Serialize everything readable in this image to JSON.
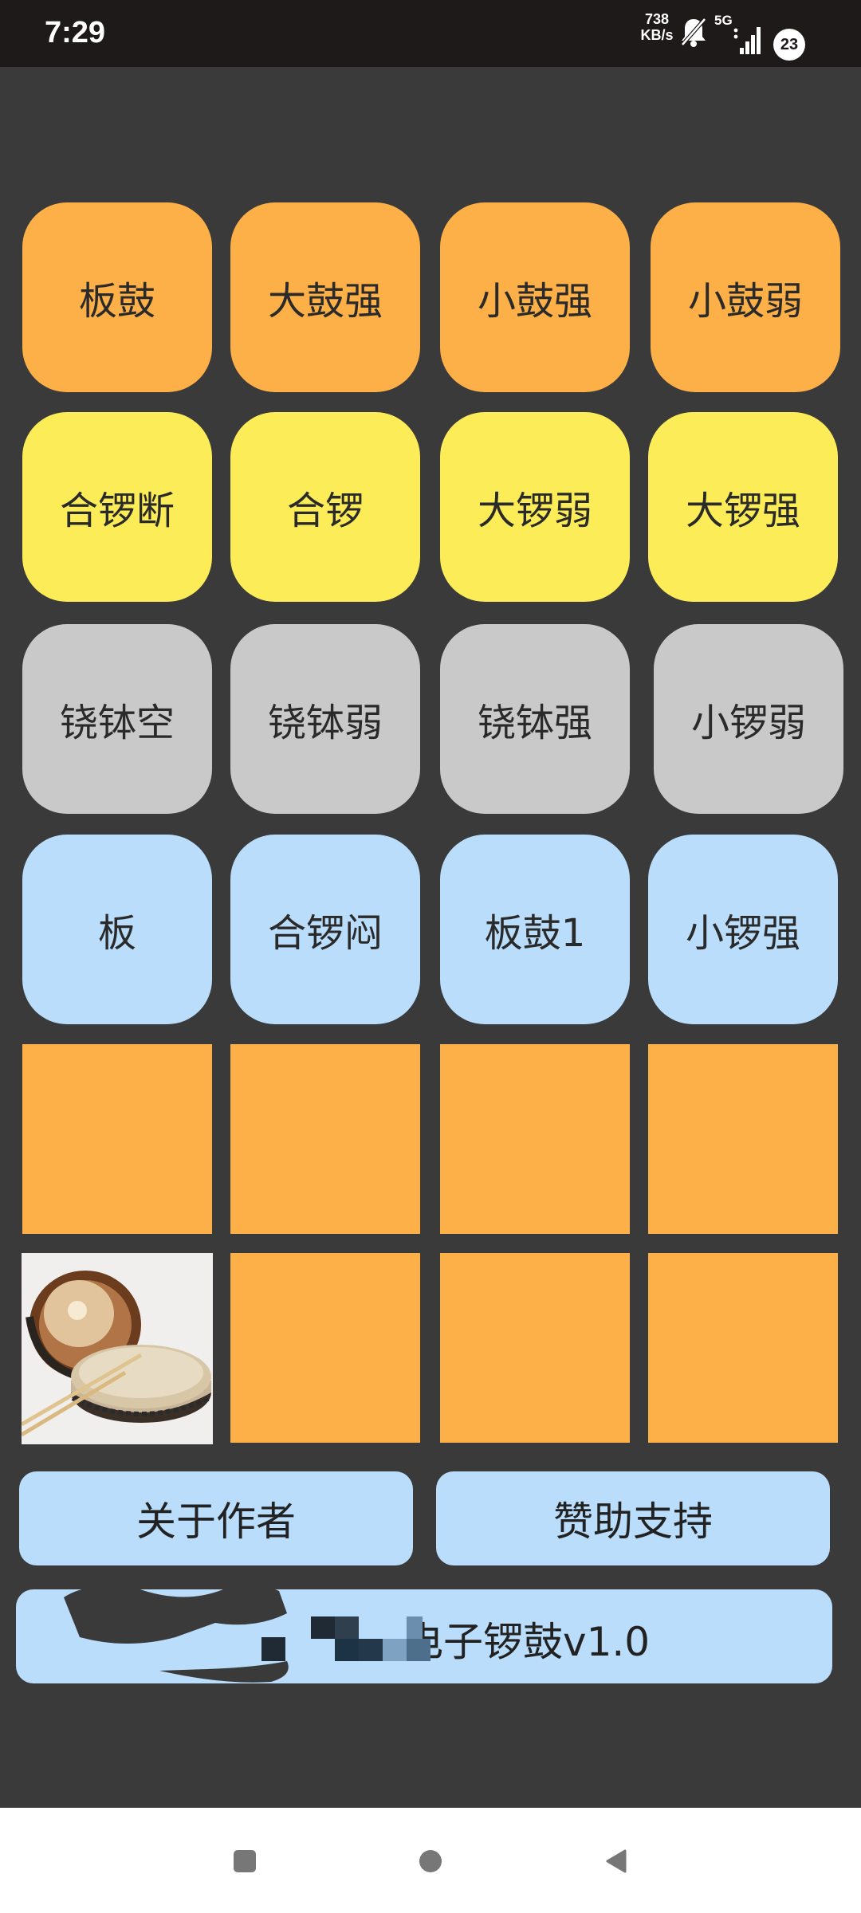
{
  "status_bar": {
    "time": "7:29",
    "speed_value": "738",
    "speed_unit": "KB/s",
    "network": "5G",
    "badge": "23",
    "icons": [
      "bell-off-icon",
      "signal-icon"
    ]
  },
  "pads": {
    "row1": [
      "板鼓",
      "大鼓强",
      "小鼓强",
      "小鼓弱"
    ],
    "row2": [
      "合锣断",
      "合锣",
      "大锣弱",
      "大锣强"
    ],
    "row3": [
      "铙钵空",
      "铙钵弱",
      "铙钵强",
      "小锣弱"
    ],
    "row4": [
      "板",
      "合锣闷",
      "板鼓1",
      "小锣强"
    ]
  },
  "image_tile": {
    "icon": "drum-image"
  },
  "buttons": {
    "about_author": "关于作者",
    "sponsor": "赞助支持"
  },
  "app_title": "电子锣鼓v1.0",
  "colors": {
    "background": "#3a3a3a",
    "orange": "#fdb047",
    "yellow": "#fced58",
    "gray": "#c9c9c9",
    "blue": "#b9ddfb"
  },
  "nav_bar": {
    "icons": [
      "recents-square-icon",
      "home-circle-icon",
      "back-triangle-icon"
    ]
  }
}
